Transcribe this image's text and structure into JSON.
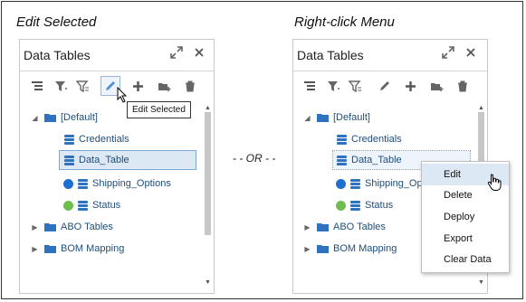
{
  "captions": {
    "left": "Edit Selected",
    "right": "Right-click Menu",
    "or": "- - OR - -"
  },
  "panel": {
    "title": "Data Tables",
    "expand_icon": "expand-diagonal-icon",
    "close_icon": "close-icon",
    "toolbar": [
      "collapse-all-icon",
      "filter-icon",
      "filter-options-icon",
      "edit-pencil-icon",
      "add-icon",
      "add-folder-icon",
      "delete-trash-icon"
    ]
  },
  "tree": {
    "default": "[Default]",
    "credentials": "Credentials",
    "data_table": "Data_Table",
    "shipping_options_full": "Shipping_Options",
    "shipping_options_clipped": "Shipping_Opti",
    "status": "Status",
    "abo_tables": "ABO Tables",
    "bom_mapping": "BOM Mapping"
  },
  "colors": {
    "blue_dot": "#1e6fd0",
    "green_dot": "#6dbd4f",
    "folder": "#2f73c0",
    "db": "#2f73c0"
  },
  "tooltip": "Edit Selected",
  "context_menu": [
    "Edit",
    "Delete",
    "Deploy",
    "Export",
    "Clear Data"
  ]
}
